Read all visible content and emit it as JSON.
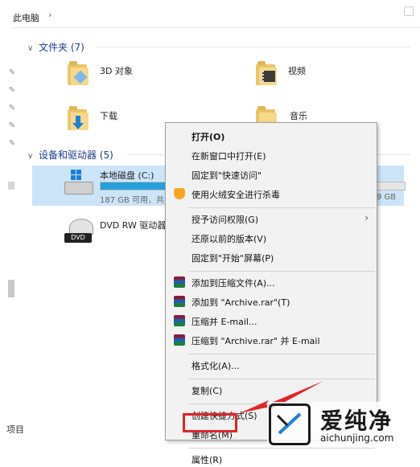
{
  "address_bar": {
    "crumb": "此电脑",
    "separator": "›"
  },
  "left_pane": {
    "footer": "项目"
  },
  "folders_group": {
    "title": "文件夹 (7)"
  },
  "folders": [
    {
      "name": "3D 对象",
      "icon": "folder-3d-icon"
    },
    {
      "name": "视频",
      "icon": "folder-video-icon"
    },
    {
      "name": "下载",
      "icon": "folder-download-icon"
    },
    {
      "name": "音乐",
      "icon": "folder-music-icon"
    }
  ],
  "drives_group": {
    "title": "设备和驱动器 (5)"
  },
  "drives": [
    {
      "name": "本地磁盘 (C:)",
      "free_text": "187 GB 可用，共",
      "right_text": "9 GB",
      "used_fraction": 0.38
    },
    {
      "name": "DVD RW 驱动器",
      "icon_label": "DVD"
    }
  ],
  "context_menu": {
    "items": [
      {
        "label": "打开(O)",
        "bold": true
      },
      {
        "label": "在新窗口中打开(E)"
      },
      {
        "label": "固定到\"快速访问\""
      },
      {
        "label": "使用火绒安全进行杀毒",
        "icon": "shield-icon"
      },
      {
        "sep": true
      },
      {
        "label": "授予访问权限(G)",
        "submenu": true
      },
      {
        "label": "还原以前的版本(V)"
      },
      {
        "label": "固定到\"开始\"屏幕(P)"
      },
      {
        "sep": true
      },
      {
        "label": "添加到压缩文件(A)...",
        "icon": "winrar-icon"
      },
      {
        "label": "添加到 \"Archive.rar\"(T)",
        "icon": "winrar-icon"
      },
      {
        "label": "压缩并 E-mail...",
        "icon": "winrar-icon"
      },
      {
        "label": "压缩到 \"Archive.rar\" 并 E-mail",
        "icon": "winrar-icon"
      },
      {
        "sep": true
      },
      {
        "label": "格式化(A)..."
      },
      {
        "sep": true
      },
      {
        "label": "复制(C)"
      },
      {
        "sep": true
      },
      {
        "label": "创建快捷方式(S)"
      },
      {
        "label": "重命名(M)"
      },
      {
        "sep": true
      },
      {
        "label": "属性(R)",
        "highlighted": true
      }
    ]
  },
  "watermark": {
    "big": "爱纯净",
    "small": "aichunjing.com"
  },
  "colors": {
    "accent": "#26a0da",
    "highlight": "#e0242a",
    "selection": "#cce4f7"
  }
}
